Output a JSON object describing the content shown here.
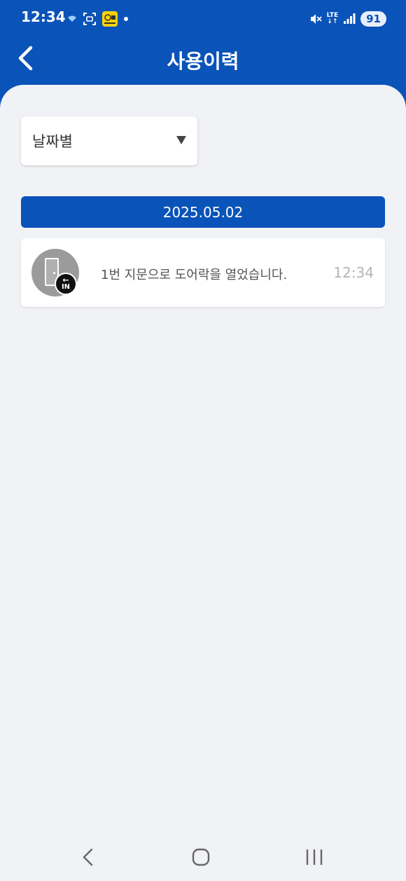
{
  "status_bar": {
    "time": "12:34",
    "network_label": "LTE",
    "battery": "91",
    "left_icons": [
      "wifi-calling-icon",
      "screenshot-icon",
      "app-notification-icon",
      "dot-icon"
    ],
    "right_icons": [
      "mute-icon",
      "lte-icon",
      "signal-icon",
      "battery-icon"
    ]
  },
  "app_bar": {
    "title": "사용이력",
    "back_icon": "chevron-left-icon"
  },
  "filter": {
    "selected": "날짜별",
    "arrow_icon": "triangle-down-icon"
  },
  "history": {
    "groups": [
      {
        "date": "2025.05.02",
        "records": [
          {
            "icon": "door-in-icon",
            "badge": "IN",
            "message": "1번 지문으로 도어락을 열었습니다.",
            "time": "12:34"
          }
        ]
      }
    ]
  },
  "nav_bar": {
    "icons": [
      "back-nav-icon",
      "home-nav-icon",
      "recents-nav-icon"
    ]
  },
  "colors": {
    "primary": "#0a53b8",
    "background": "#f1f2f6",
    "card": "#ffffff",
    "time_text": "#b5b5b5"
  }
}
